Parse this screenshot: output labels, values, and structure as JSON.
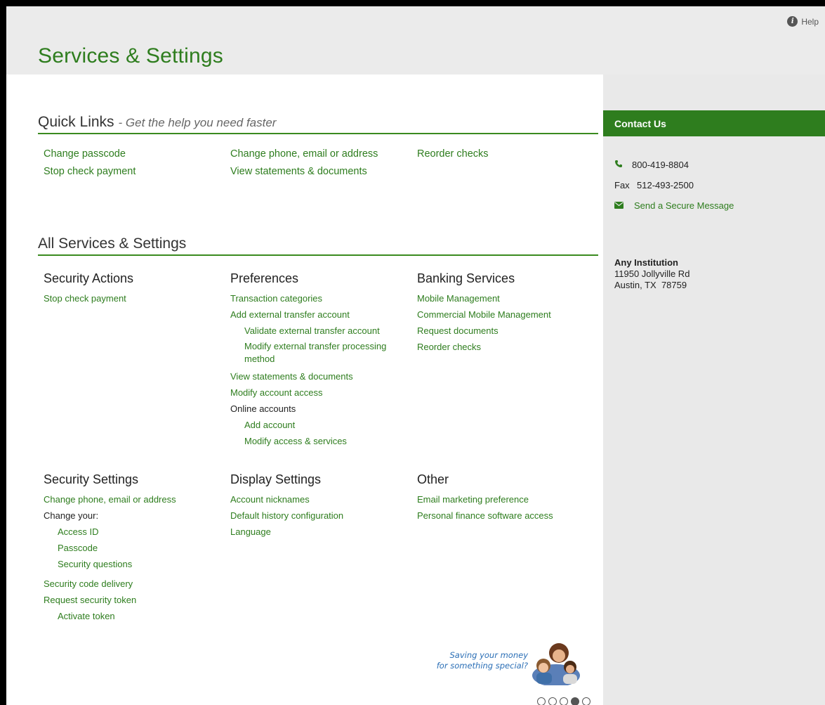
{
  "header": {
    "title": "Services & Settings",
    "help_label": "Help"
  },
  "quick_links": {
    "title": "Quick Links",
    "subtitle": "- Get the help you need faster",
    "columns": [
      [
        "Change passcode",
        "Stop check payment"
      ],
      [
        "Change phone, email or address",
        "View statements & documents"
      ],
      [
        "Reorder checks"
      ]
    ]
  },
  "all_services": {
    "title": "All Services & Settings",
    "security_actions": {
      "title": "Security Actions",
      "items": [
        "Stop check payment"
      ]
    },
    "preferences": {
      "title": "Preferences",
      "transaction_categories": "Transaction categories",
      "add_external": "Add external transfer account",
      "validate_external": "Validate external transfer account",
      "modify_external": "Modify external transfer processing method",
      "view_statements": "View statements & documents",
      "modify_access": "Modify account access",
      "online_accounts": "Online accounts",
      "add_account": "Add account",
      "modify_access_services": "Modify access & services"
    },
    "banking_services": {
      "title": "Banking Services",
      "items": [
        "Mobile Management",
        "Commercial Mobile Management",
        "Request documents",
        "Reorder checks"
      ]
    },
    "security_settings": {
      "title": "Security Settings",
      "change_contact": "Change phone, email or address",
      "change_your": "Change your:",
      "access_id": "Access ID",
      "passcode": "Passcode",
      "security_questions": "Security questions",
      "security_code_delivery": "Security code delivery",
      "request_token": "Request security token",
      "activate_token": "Activate token"
    },
    "display_settings": {
      "title": "Display Settings",
      "items": [
        "Account nicknames",
        "Default history configuration",
        "Language"
      ]
    },
    "other": {
      "title": "Other",
      "items": [
        "Email marketing preference",
        "Personal finance software access"
      ]
    }
  },
  "sidebar": {
    "contact_title": "Contact Us",
    "phone": "800-419-8804",
    "fax_label": "Fax",
    "fax": "512-493-2500",
    "secure_message": "Send a Secure Message",
    "institution_name": "Any Institution",
    "address_line1": "11950 Jollyville Rd",
    "address_line2": "Austin, TX  78759"
  },
  "promo": {
    "line1": "Saving your money",
    "line2": "for something special?",
    "slide_count": 5,
    "active_slide": 4
  },
  "colors": {
    "brand_green": "#2e7d1e",
    "header_gray": "#ebebeb",
    "sidebar_gray": "#e9e9e9"
  }
}
